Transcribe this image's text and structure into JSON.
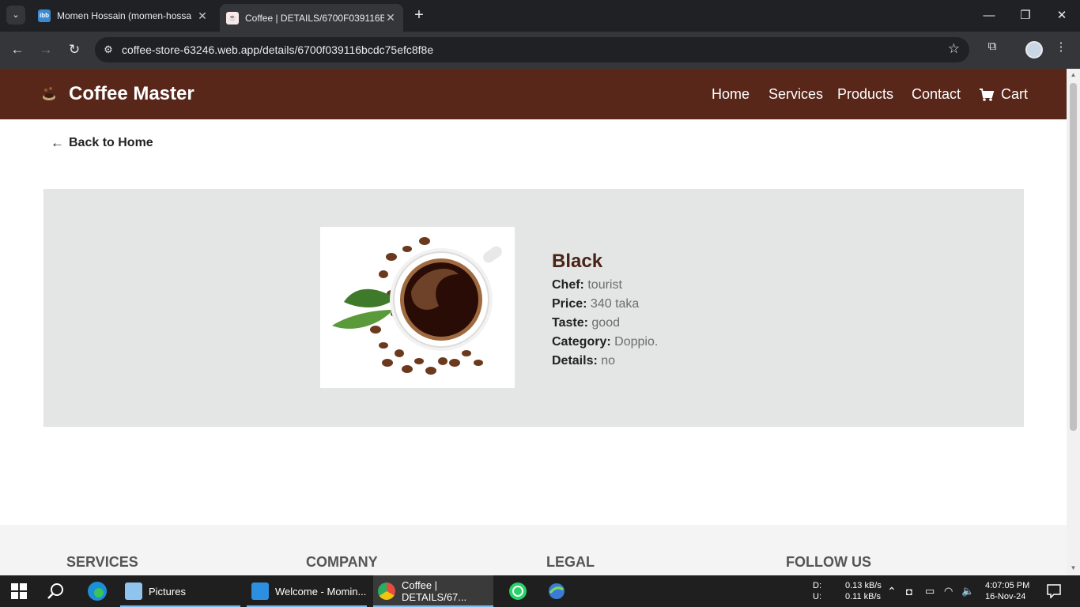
{
  "browser": {
    "tabs": [
      {
        "title": "Momen Hossain (momen-hossa",
        "favicon": "ibb"
      },
      {
        "title": "Coffee | DETAILS/6700F039116B",
        "favicon": "coffee-cup"
      }
    ],
    "url": "coffee-store-63246.web.app/details/6700f039116bcdc75efc8f8e"
  },
  "site": {
    "brand": "Coffee Master",
    "nav": {
      "home": "Home",
      "services": "Services",
      "products": "Products",
      "contact": "Contact",
      "cart": "Cart"
    },
    "back_label": "Back to Home",
    "coffee": {
      "name": "Black",
      "chef_label": "Chef:",
      "chef": "tourist",
      "price_label": "Price:",
      "price": "340 taka",
      "taste_label": "Taste:",
      "taste": "good",
      "category_label": "Category:",
      "category": "Doppio.",
      "details_label": "Details:",
      "details": "no"
    },
    "footer": {
      "services": "SERVICES",
      "company": "COMPANY",
      "legal": "LEGAL",
      "follow": "FOLLOW US"
    },
    "colors": {
      "nav_bg": "#58271a",
      "title": "#4a2216",
      "panel_bg": "#e4e5e5"
    }
  },
  "taskbar": {
    "apps": [
      {
        "label": "Pictures"
      },
      {
        "label": "Welcome - Momin..."
      },
      {
        "label": "Coffee | DETAILS/67..."
      }
    ],
    "net_d_label": "D:",
    "net_d": "0.13 kB/s",
    "net_u_label": "U:",
    "net_u": "0.11 kB/s",
    "time": "4:07:05 PM",
    "date": "16-Nov-24"
  }
}
